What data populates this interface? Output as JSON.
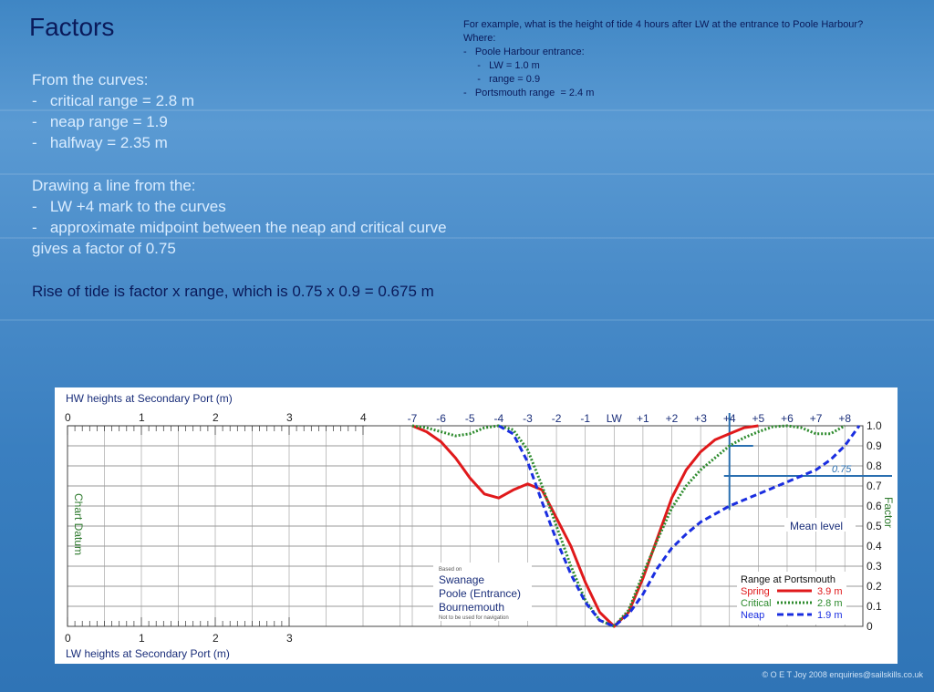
{
  "slide": {
    "title": "Factors",
    "example": {
      "lines": [
        "For example, what is the height of tide 4 hours after LW at the entrance to Poole Harbour?",
        "Where:",
        "-   Poole Harbour entrance:",
        "     -   LW = 1.0 m",
        "     -   range = 0.9",
        "-   Portsmouth range  = 2.4 m"
      ]
    },
    "curves_text": {
      "lines": [
        "From the curves:",
        "-   critical range = 2.8 m",
        "-   neap range = 1.9",
        "-   halfway = 2.35 m"
      ]
    },
    "drawing_text": {
      "lines": [
        "Drawing a line from the:",
        "-   LW +4 mark to the curves",
        "-   approximate midpoint between the neap and critical curve",
        "gives a factor of 0.75"
      ]
    },
    "rise_text": "Rise of tide is factor x range,  which is  0.75 x 0.9 = 0.675 m",
    "copyright": "© O E T Joy 2008 enquiries@sailskills.co.uk"
  },
  "chart_data": {
    "type": "line",
    "hw_axis_label": "HW heights at Secondary Port (m)",
    "lw_axis_label": "LW heights at Secondary Port (m)",
    "hw_axis_ticks": [
      "0",
      "1",
      "2",
      "3",
      "4"
    ],
    "lw_axis_ticks": [
      "0",
      "1",
      "2",
      "3"
    ],
    "left_axis_label": "Chart Datum",
    "x_ticks": [
      "-7",
      "-6",
      "-5",
      "-4",
      "-3",
      "-2",
      "-1",
      "LW",
      "+1",
      "+2",
      "+3",
      "+4",
      "+5",
      "+6",
      "+7",
      "+8"
    ],
    "x_values": [
      -7,
      -6,
      -5,
      -4,
      -3,
      -2,
      -1,
      0,
      1,
      2,
      3,
      4,
      5,
      6,
      7,
      8
    ],
    "y_ticks": [
      "1.0",
      "0.9",
      "0.8",
      "0.7",
      "0.6",
      "0.5",
      "0.4",
      "0.3",
      "0.2",
      "0.1",
      "0"
    ],
    "y_values": [
      1.0,
      0.9,
      0.8,
      0.7,
      0.6,
      0.5,
      0.4,
      0.3,
      0.2,
      0.1,
      0
    ],
    "ylabel": "Factor",
    "ylim": [
      0,
      1
    ],
    "xlim": [
      -7,
      8.5
    ],
    "mean_level_label": "Mean level",
    "mean_level_value": 0.5,
    "factor_annotation": "0.75",
    "construction": {
      "x": 4,
      "y": 0.75
    },
    "based_on_label": "Based on",
    "ports": [
      "Swanage",
      "Poole (Entrance)",
      "Bournemouth"
    ],
    "disclaimer": "Not to be used for navigation",
    "legend_title": "Range at Portsmouth",
    "series": [
      {
        "name": "Spring",
        "range": "3.9 m",
        "color": "#e0191b",
        "dash": "solid",
        "x": [
          -7,
          -6.5,
          -6,
          -5.5,
          -5,
          -4.5,
          -4,
          -3.5,
          -3,
          -2.5,
          -2,
          -1.5,
          -1,
          -0.5,
          0,
          0.5,
          1,
          1.5,
          2,
          2.5,
          3,
          3.5,
          4,
          4.5,
          5
        ],
        "y": [
          1.0,
          0.97,
          0.92,
          0.84,
          0.74,
          0.66,
          0.64,
          0.68,
          0.71,
          0.68,
          0.54,
          0.4,
          0.22,
          0.07,
          0.0,
          0.07,
          0.24,
          0.44,
          0.64,
          0.78,
          0.87,
          0.93,
          0.96,
          0.99,
          1.0
        ]
      },
      {
        "name": "Critical",
        "range": "2.8 m",
        "color": "#2e8b2e",
        "dash": "dotted",
        "x": [
          -7,
          -6.5,
          -6,
          -5.5,
          -5,
          -4.5,
          -4,
          -3.5,
          -3,
          -2.5,
          -2,
          -1.5,
          -1,
          -0.5,
          0,
          0.5,
          1,
          1.5,
          2,
          2.5,
          3,
          3.5,
          4,
          4.5,
          5,
          5.5,
          6,
          6.5,
          7,
          7.5,
          8
        ],
        "y": [
          1.0,
          0.99,
          0.97,
          0.95,
          0.96,
          0.99,
          1.0,
          0.98,
          0.88,
          0.7,
          0.5,
          0.3,
          0.13,
          0.03,
          0.0,
          0.08,
          0.26,
          0.43,
          0.59,
          0.7,
          0.78,
          0.84,
          0.9,
          0.94,
          0.97,
          0.995,
          1.0,
          0.99,
          0.96,
          0.96,
          1.0
        ]
      },
      {
        "name": "Neap",
        "range": "1.9 m",
        "color": "#1a2ee0",
        "dash": "dashed",
        "x": [
          -4,
          -3.5,
          -3,
          -2.5,
          -2,
          -1.5,
          -1,
          -0.5,
          0,
          0.5,
          1,
          1.5,
          2,
          2.5,
          3,
          3.5,
          4,
          4.5,
          5,
          5.5,
          6,
          6.5,
          7,
          7.5,
          8,
          8.5
        ],
        "y": [
          1.0,
          0.96,
          0.82,
          0.62,
          0.43,
          0.26,
          0.12,
          0.03,
          0.0,
          0.06,
          0.16,
          0.29,
          0.39,
          0.46,
          0.52,
          0.56,
          0.6,
          0.63,
          0.66,
          0.69,
          0.72,
          0.75,
          0.78,
          0.83,
          0.9,
          1.0
        ]
      }
    ]
  }
}
